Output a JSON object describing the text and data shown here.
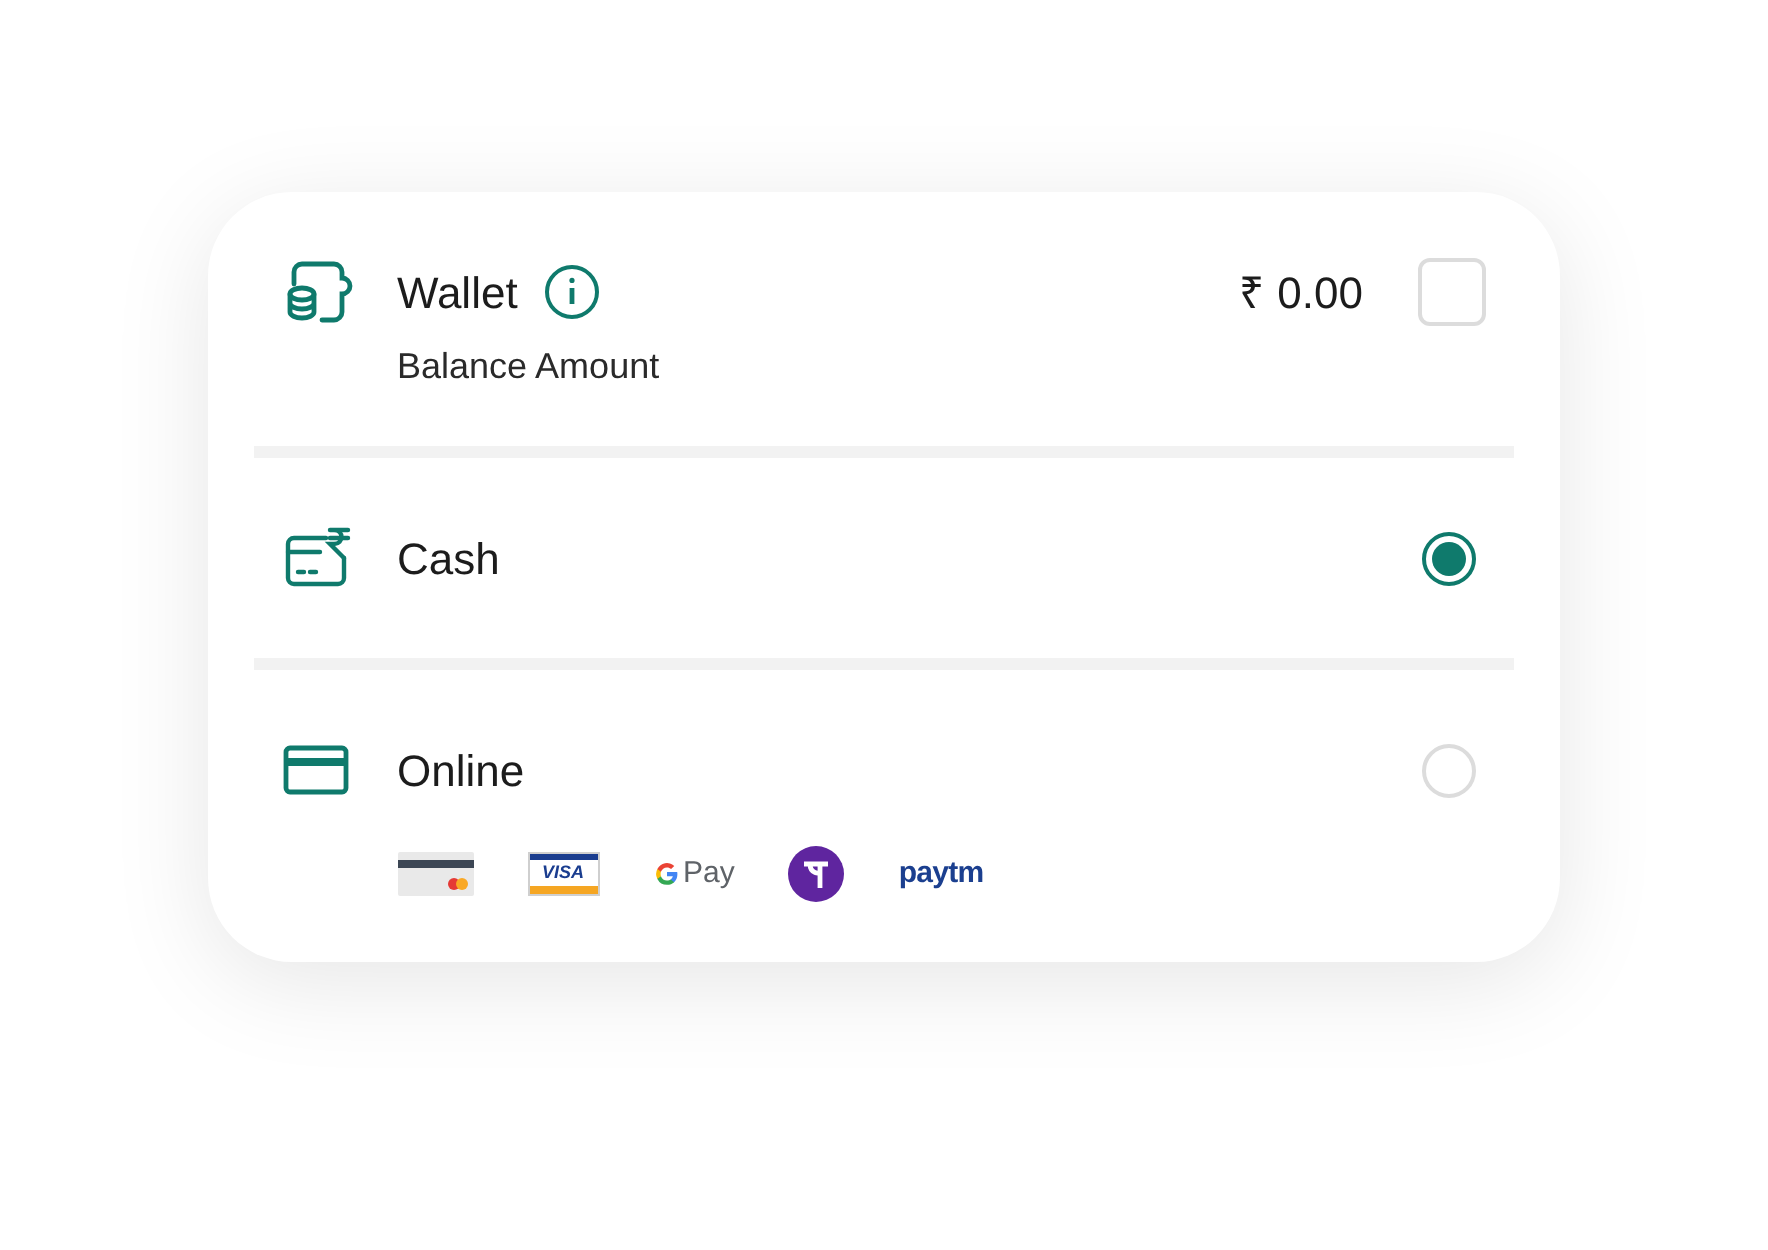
{
  "options": [
    {
      "kind": "wallet",
      "label": "Wallet",
      "amount": "₹ 0.00",
      "sublabel": "Balance Amount",
      "checked": false
    },
    {
      "kind": "cash",
      "label": "Cash",
      "selected": true
    },
    {
      "kind": "online",
      "label": "Online",
      "selected": false,
      "methods": [
        {
          "kind": "card"
        },
        {
          "kind": "visa",
          "label": "VISA"
        },
        {
          "kind": "gpay",
          "label": "Pay"
        },
        {
          "kind": "phonepe"
        },
        {
          "kind": "paytm",
          "label": "paytm"
        }
      ]
    }
  ]
}
